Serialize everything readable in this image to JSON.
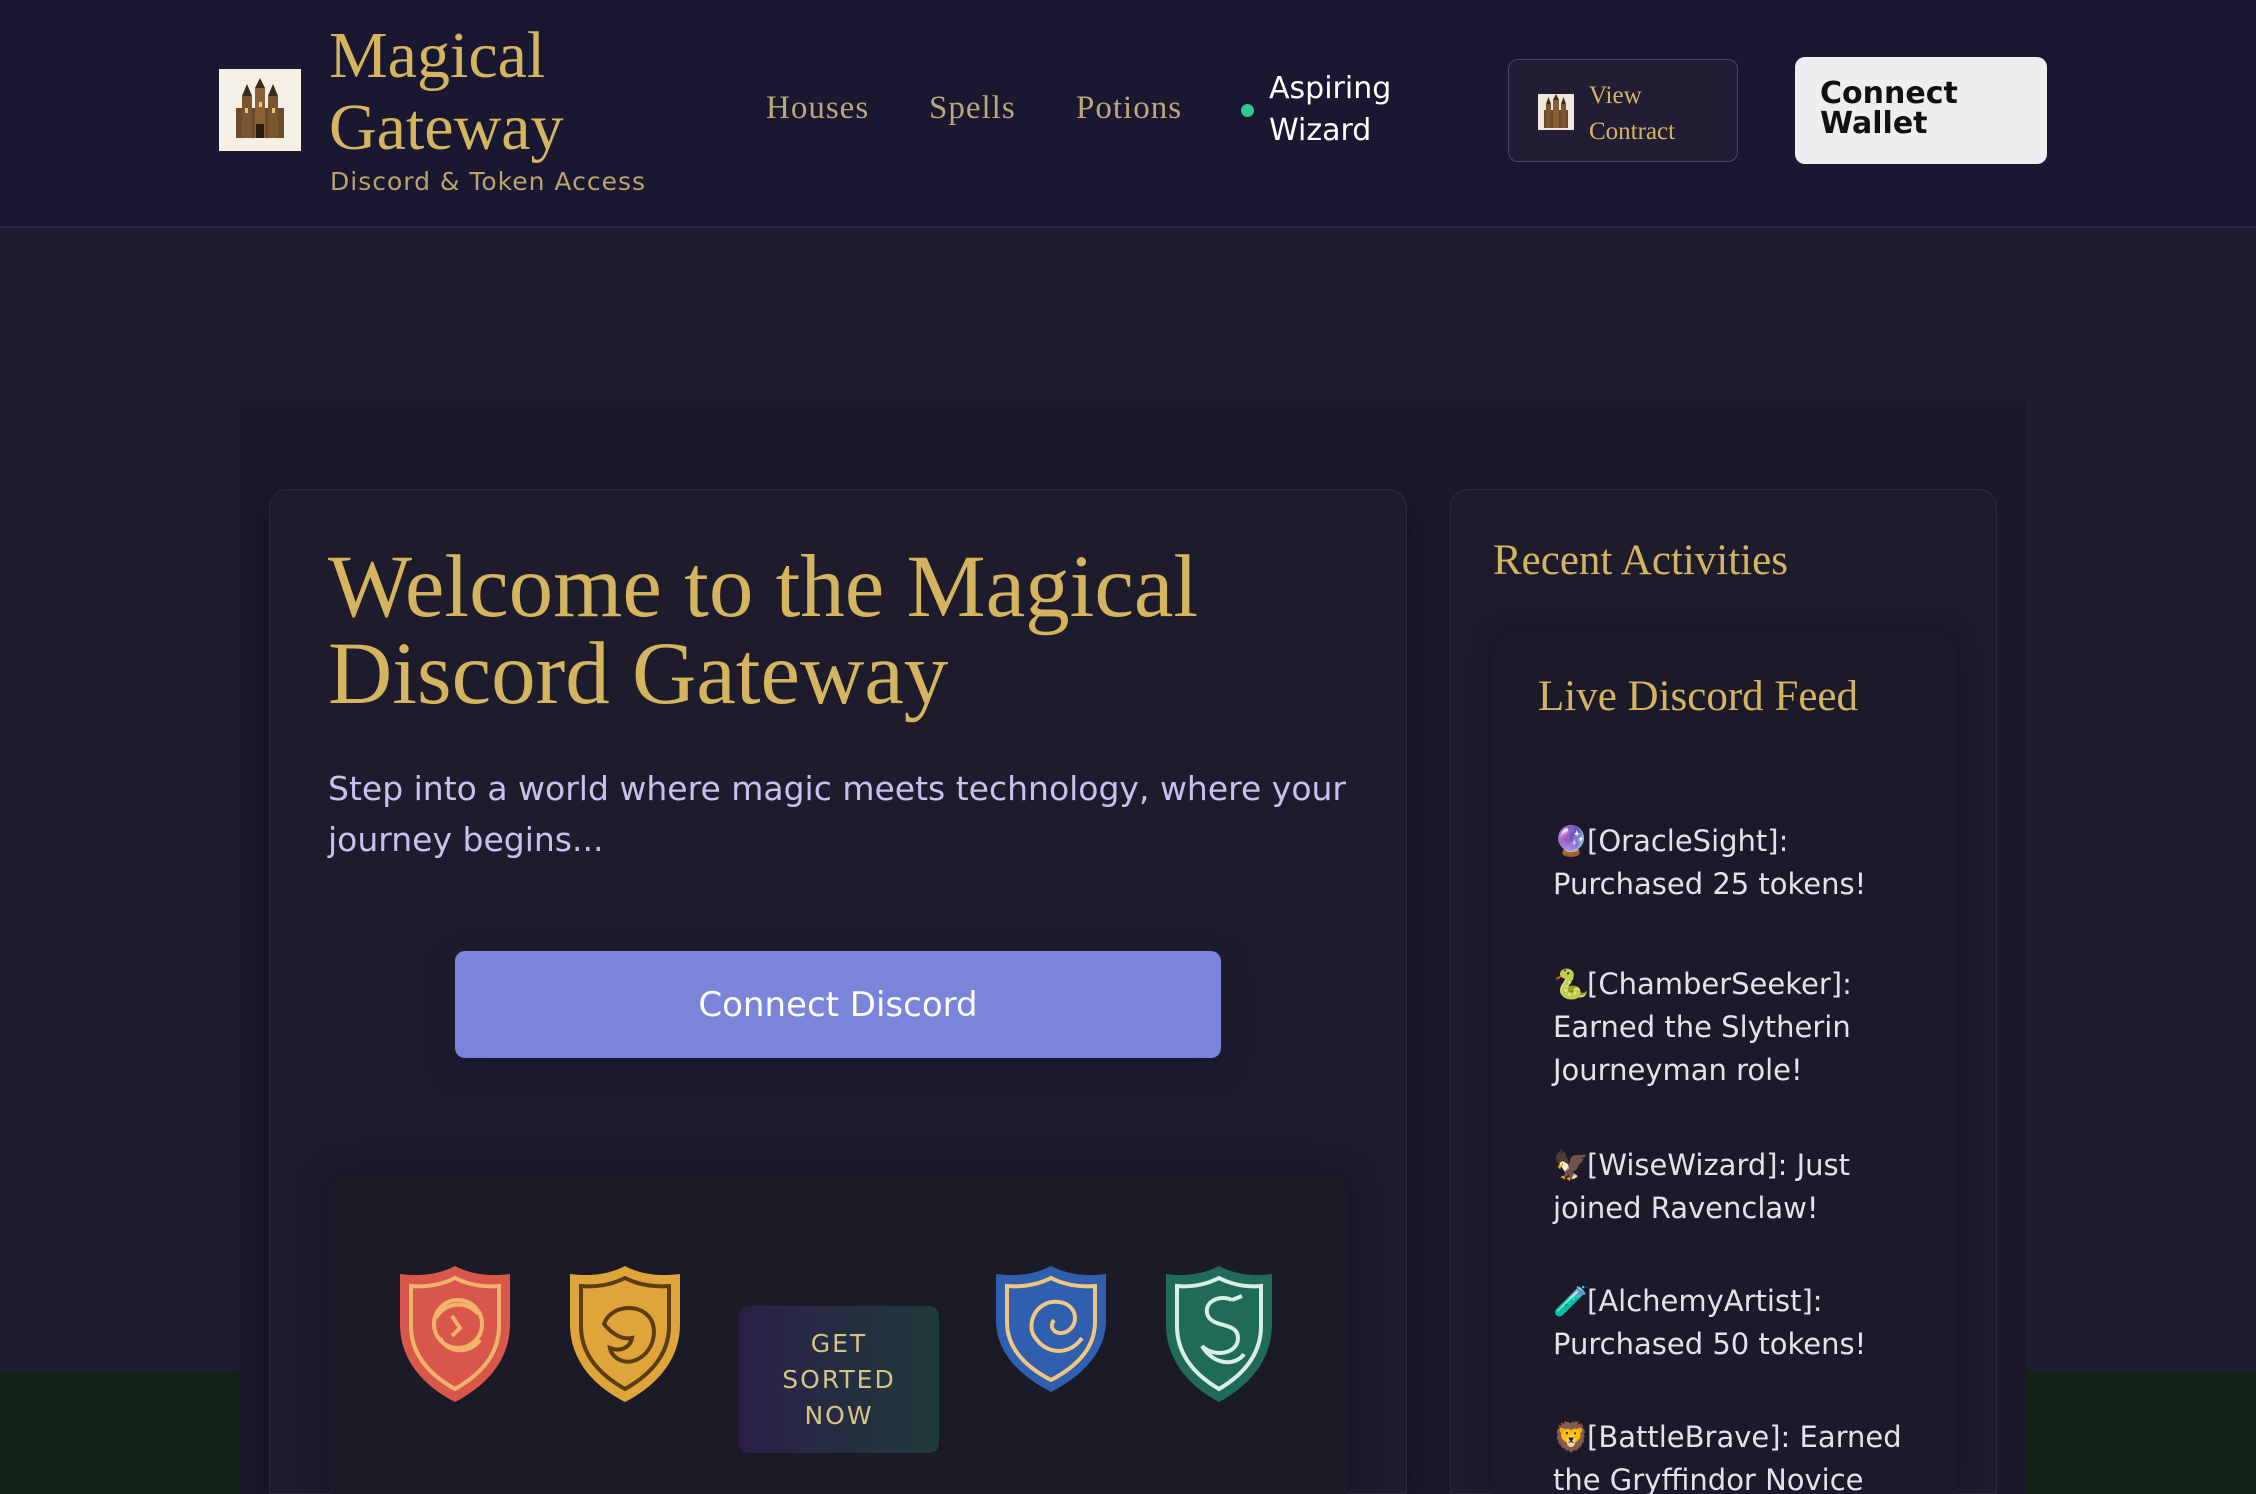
{
  "header": {
    "brand_title": "Magical Gateway",
    "brand_subtitle": "Discord & Token Access",
    "nav": [
      "Houses",
      "Spells",
      "Potions"
    ],
    "status_label": "Aspiring Wizard",
    "view_contract_label": "View Contract",
    "connect_wallet_label": "Connect Wallet"
  },
  "welcome": {
    "title": "Welcome to the Magical Discord Gateway",
    "text": "Step into a world where magic meets technology, where your journey begins...",
    "discord_button": "Connect Discord",
    "sorted_button": "GET SORTED NOW"
  },
  "activities": {
    "title": "Recent Activities",
    "feed_title": "Live Discord Feed",
    "items": [
      {
        "emoji": "🔮",
        "text": "[OracleSight]: Purchased 25 tokens!"
      },
      {
        "emoji": "🐍",
        "text": "[ChamberSeeker]: Earned the Slytherin Journeyman role!"
      },
      {
        "emoji": "🦅",
        "text": "[WiseWizard]: Just joined Ravenclaw!"
      },
      {
        "emoji": "🧪",
        "text": "[AlchemyArtist]: Purchased 50 tokens!"
      },
      {
        "emoji": "🦁",
        "text": "[BattleBrave]: Earned the Gryffindor Novice"
      }
    ]
  },
  "colors": {
    "gold": "#d4b45e",
    "discord": "#7a85d9",
    "status_online": "#2fc98e",
    "gryffindor": "#d9574a",
    "hufflepuff": "#e0a53a",
    "ravenclaw": "#2f5fae",
    "slytherin": "#1f6b57"
  },
  "icons": [
    "castle-icon",
    "gryffindor-crest-icon",
    "hufflepuff-crest-icon",
    "ravenclaw-crest-icon",
    "slytherin-crest-icon"
  ]
}
